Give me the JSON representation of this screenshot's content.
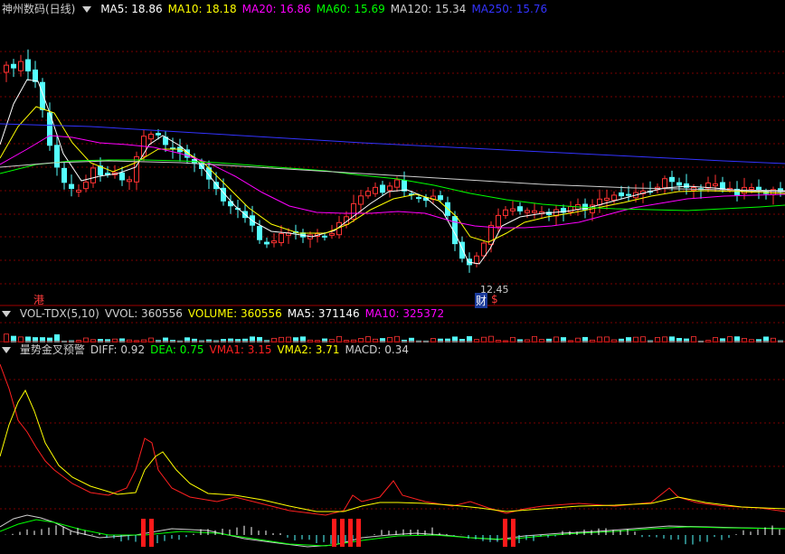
{
  "main": {
    "title": "神州数码(日线)",
    "indicators": [
      {
        "label": "MA5: 18.86",
        "color": "#ffffff"
      },
      {
        "label": "MA10: 18.18",
        "color": "#ffff00"
      },
      {
        "label": "MA20: 16.86",
        "color": "#ff00ff"
      },
      {
        "label": "MA60: 15.69",
        "color": "#00ff00"
      },
      {
        "label": "MA120: 15.34",
        "color": "#cfcfcf"
      },
      {
        "label": "MA250: 15.76",
        "color": "#3333ff"
      }
    ],
    "low_label": "12.45",
    "tag_gang": "港",
    "tag_cai": "财",
    "tag_s": "$"
  },
  "volume": {
    "indicators": [
      {
        "label": "VOL-TDX(5,10)",
        "color": "#cfcfcf"
      },
      {
        "label": "VVOL: 360556",
        "color": "#cfcfcf"
      },
      {
        "label": "VOLUME: 360556",
        "color": "#ffff00"
      },
      {
        "label": "MA5: 371146",
        "color": "#ffffff"
      },
      {
        "label": "MA10: 325372",
        "color": "#ff00ff"
      }
    ]
  },
  "macd": {
    "indicators": [
      {
        "label": "量势金叉预警",
        "color": "#cfcfcf"
      },
      {
        "label": "DIFF: 0.92",
        "color": "#cfcfcf"
      },
      {
        "label": "DEA: 0.75",
        "color": "#00ff00"
      },
      {
        "label": "VMA1: 3.15",
        "color": "#ff2020"
      },
      {
        "label": "VMA2: 3.71",
        "color": "#ffff00"
      },
      {
        "label": "MACD: 0.34",
        "color": "#cfcfcf"
      }
    ]
  },
  "colors": {
    "up": "#ff3232",
    "down": "#54ffff",
    "grid": "#7a0000"
  }
}
